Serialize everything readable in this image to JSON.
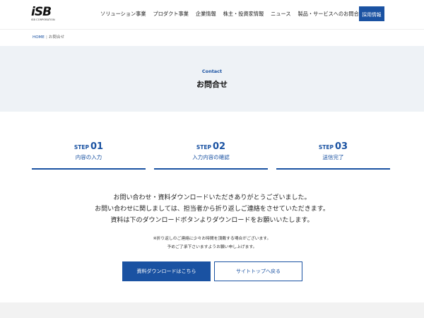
{
  "header": {
    "logo_mark": "iSB",
    "logo_sub": "ISB CORPORATION",
    "nav": [
      "ソリューション事業",
      "プロダクト事業",
      "企業情報",
      "株主・投資家情報",
      "ニュース",
      "製品・サービスへのお問合せ"
    ],
    "recruit_label": "採用情報"
  },
  "breadcrumb": {
    "home": "HOME",
    "separator": "|",
    "current": "お問合せ"
  },
  "title": {
    "en": "Contact",
    "ja": "お問合せ"
  },
  "steps": [
    {
      "word": "STEP",
      "num": "01",
      "label": "内容の入力"
    },
    {
      "word": "STEP",
      "num": "02",
      "label": "入力内容の確認"
    },
    {
      "word": "STEP",
      "num": "03",
      "label": "送信完了"
    }
  ],
  "message": {
    "line1": "お問い合わせ・資料ダウンロードいただきありがとうございました。",
    "line2": "お問い合わせに関しましては、担当者から折り返しご連絡をさせていただきます。",
    "line3": "資料は下のダウンロードボタンよりダウンロードをお願いいたします。"
  },
  "note": {
    "line1": "※折り返しのご連絡に少々お時間を頂戴する場合がございます。",
    "line2": "予めご了承下さいますようお願い申し上げます。"
  },
  "buttons": {
    "download": "資料ダウンロードはこちら",
    "top": "サイトトップへ戻る"
  },
  "colors": {
    "brand": "#1a52a2",
    "band": "#eef2f6"
  }
}
